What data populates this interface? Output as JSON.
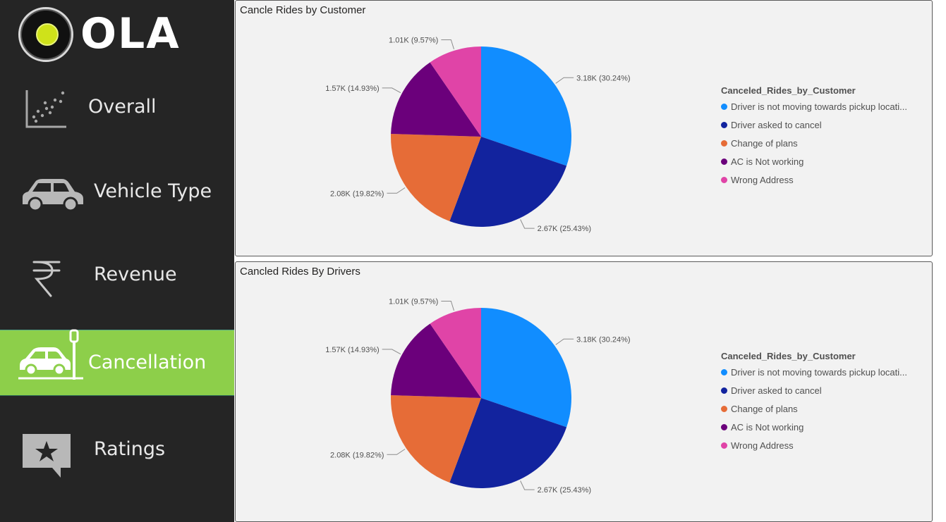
{
  "app": {
    "logo_text": "OLA"
  },
  "sidebar": {
    "items": [
      {
        "label": "Overall",
        "icon": "scatter-chart-icon"
      },
      {
        "label": "Vehicle Type",
        "icon": "car-icon"
      },
      {
        "label": "Revenue",
        "icon": "rupee-icon"
      },
      {
        "label": "Cancellation",
        "icon": "car-crash-icon",
        "active": true
      },
      {
        "label": "Ratings",
        "icon": "star-speech-bubble-icon"
      }
    ]
  },
  "colors": {
    "sidebar_bg": "#252525",
    "active_bg": "#8dcf4a",
    "panel_bg": "#f2f2f2"
  },
  "panels": [
    {
      "title": "Cancle Rides by Customer"
    },
    {
      "title": "Cancled Rides By Drivers"
    }
  ],
  "chart_data": [
    {
      "type": "pie",
      "title": "Cancle Rides by Customer",
      "legend_title": "Canceled_Rides_by_Customer",
      "legend_position": "right",
      "categories": [
        "Driver is not moving towards pickup locati...",
        "Driver asked to cancel",
        "Change of plans",
        "AC is Not working",
        "Wrong Address"
      ],
      "values": [
        30.24,
        25.43,
        19.82,
        14.93,
        9.57
      ],
      "data_labels": [
        "3.18K (30.24%)",
        "2.67K (25.43%)",
        "2.08K (19.82%)",
        "1.57K (14.93%)",
        "1.01K (9.57%)"
      ],
      "colors": [
        "#118dff",
        "#12239e",
        "#e66c37",
        "#6b007b",
        "#e044a7"
      ]
    },
    {
      "type": "pie",
      "title": "Cancled Rides By Drivers",
      "legend_title": "Canceled_Rides_by_Customer",
      "legend_position": "right",
      "categories": [
        "Driver is not moving towards pickup locati...",
        "Driver asked to cancel",
        "Change of plans",
        "AC is Not working",
        "Wrong Address"
      ],
      "values": [
        30.24,
        25.43,
        19.82,
        14.93,
        9.57
      ],
      "data_labels": [
        "3.18K (30.24%)",
        "2.67K (25.43%)",
        "2.08K (19.82%)",
        "1.57K (14.93%)",
        "1.01K (9.57%)"
      ],
      "colors": [
        "#118dff",
        "#12239e",
        "#e66c37",
        "#6b007b",
        "#e044a7"
      ]
    }
  ]
}
